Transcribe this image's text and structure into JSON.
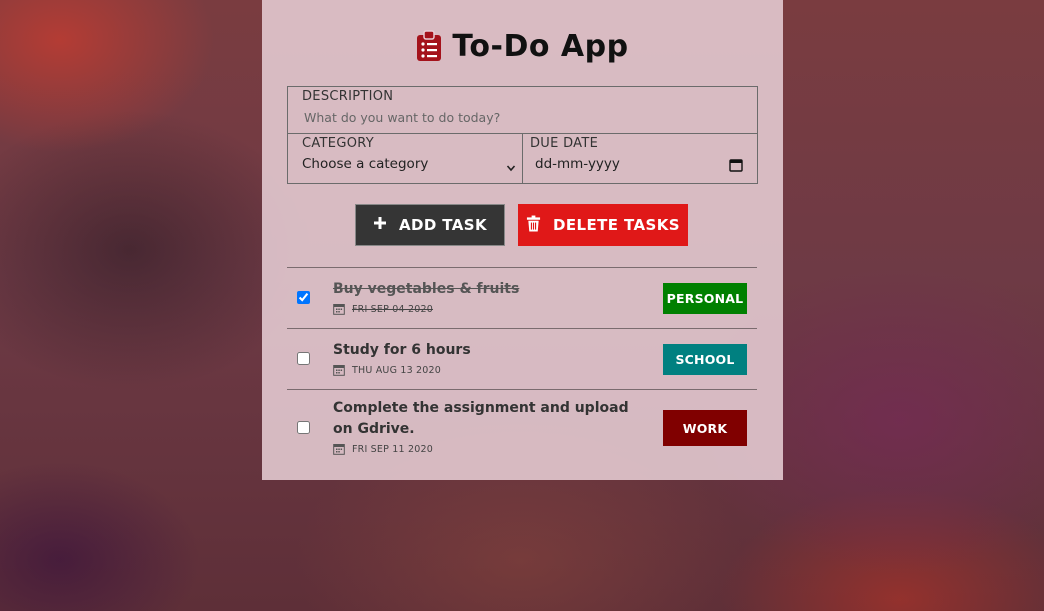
{
  "app": {
    "title": "To-Do App",
    "title_icon": "clipboard-list-icon"
  },
  "form": {
    "description_label": "DESCRIPTION",
    "description_placeholder": "What do you want to do today?",
    "description_value": "",
    "category_label": "CATEGORY",
    "category_value": "Choose a category",
    "due_label": "DUE DATE",
    "due_value": "dd-mm-yyyy"
  },
  "buttons": {
    "add_label": "ADD TASK",
    "add_icon": "plus-icon",
    "delete_label": "DELETE TASKS",
    "delete_icon": "trash-icon"
  },
  "tasks": [
    {
      "name": "Buy vegetables & fruits",
      "date": "FRI SEP 04 2020",
      "tag": "PERSONAL",
      "tag_color": "#008000",
      "checked": true
    },
    {
      "name": "Study for 6 hours",
      "date": "THU AUG 13 2020",
      "tag": "SCHOOL",
      "tag_color": "#008080",
      "checked": false
    },
    {
      "name": "Complete the assignment and upload on Gdrive.",
      "date": "FRI SEP 11 2020",
      "tag": "WORK",
      "tag_color": "#800000",
      "checked": false
    }
  ],
  "colors": {
    "add_button": "#353535",
    "delete_button": "#e01818",
    "title_icon": "#a4121b"
  }
}
